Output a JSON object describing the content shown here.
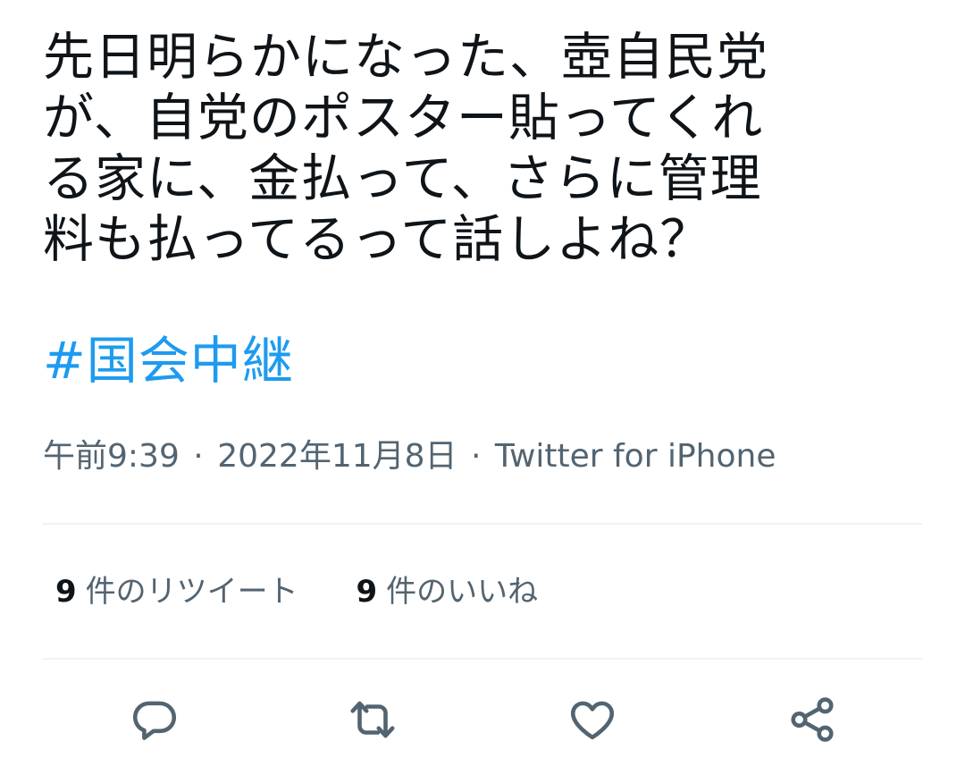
{
  "tweet": {
    "text_lines": [
      "先日明らかになった、壺自民党",
      "が、自党のポスター貼ってくれ",
      "る家に、金払って、さらに管理",
      "料も払ってるって話しよね？"
    ],
    "hashtag": "#国会中継",
    "time": "午前9:39",
    "date": "2022年11月8日",
    "separator": "·",
    "source": "Twitter for iPhone"
  },
  "stats": {
    "retweets_count": "9",
    "retweets_label": "件のリツイート",
    "likes_count": "9",
    "likes_label": "件のいいね"
  },
  "actions": [
    {
      "icon": "reply-icon"
    },
    {
      "icon": "retweet-icon"
    },
    {
      "icon": "like-icon"
    },
    {
      "icon": "share-icon"
    }
  ],
  "colors": {
    "text": "#0f1419",
    "secondary": "#536471",
    "link": "#1d9bf0",
    "divider": "#eff3f4"
  }
}
